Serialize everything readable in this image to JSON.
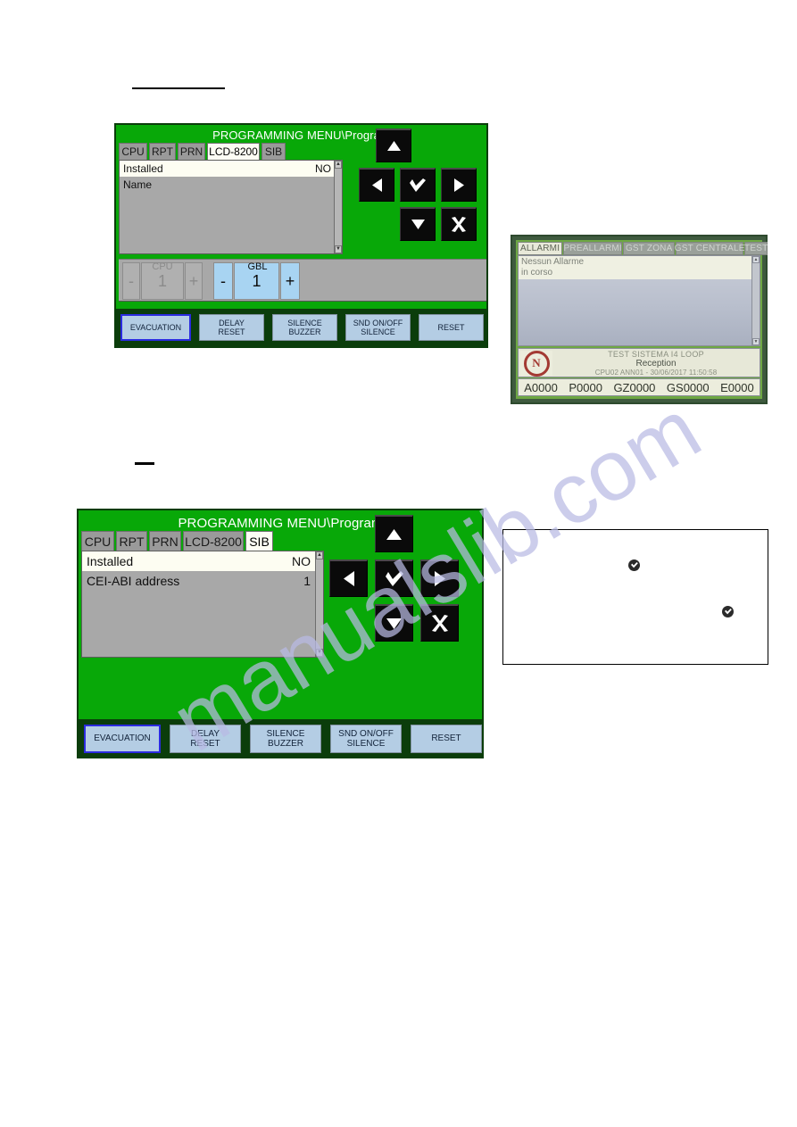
{
  "document": {
    "watermark": "manualslib.com",
    "rules": [
      "heading-underline-top",
      "heading-underline-mid"
    ]
  },
  "panel_lcd8200": {
    "title": "PROGRAMMING MENU\\Program",
    "tabs": [
      {
        "label": "CPU",
        "active": false
      },
      {
        "label": "RPT",
        "active": false
      },
      {
        "label": "PRN",
        "active": false
      },
      {
        "label": "LCD-8200",
        "active": true
      },
      {
        "label": "SIB",
        "active": false
      }
    ],
    "rows": [
      {
        "label": "Installed",
        "value": "NO",
        "selected": true
      },
      {
        "label": "Name",
        "value": "",
        "selected": false
      }
    ],
    "keypad": [
      {
        "name": "up-arrow-icon",
        "glyph": "up"
      },
      {
        "name": "left-arrow-icon",
        "glyph": "left"
      },
      {
        "name": "check-icon",
        "glyph": "check"
      },
      {
        "name": "right-arrow-icon",
        "glyph": "right"
      },
      {
        "name": "down-arrow-icon",
        "glyph": "down"
      },
      {
        "name": "close-x-icon",
        "glyph": "cross"
      }
    ],
    "steppers": [
      {
        "label": "CPU",
        "value": "1",
        "minus": "-",
        "plus": "+",
        "state": "disabled"
      },
      {
        "label": "GBL",
        "value": "1",
        "minus": "-",
        "plus": "+",
        "state": "active"
      }
    ],
    "commands": [
      {
        "label": "EVACUATION",
        "focused": true
      },
      {
        "label": "DELAY\nRESET",
        "focused": false
      },
      {
        "label": "SILENCE\nBUZZER",
        "focused": false
      },
      {
        "label": "SND ON/OFF\nSILENCE",
        "focused": false
      },
      {
        "label": "RESET",
        "focused": false
      }
    ]
  },
  "panel_sib": {
    "title": "PROGRAMMING MENU\\Program",
    "tabs": [
      {
        "label": "CPU",
        "active": false
      },
      {
        "label": "RPT",
        "active": false
      },
      {
        "label": "PRN",
        "active": false
      },
      {
        "label": "LCD-8200",
        "active": false
      },
      {
        "label": "SIB",
        "active": true
      }
    ],
    "rows": [
      {
        "label": "Installed",
        "value": "NO",
        "selected": true
      },
      {
        "label": "CEI-ABI address",
        "value": "1",
        "selected": false
      }
    ],
    "keypad": [
      {
        "name": "up-arrow-icon",
        "glyph": "up"
      },
      {
        "name": "left-arrow-icon",
        "glyph": "left"
      },
      {
        "name": "check-icon",
        "glyph": "check"
      },
      {
        "name": "right-arrow-icon",
        "glyph": "right"
      },
      {
        "name": "down-arrow-icon",
        "glyph": "down"
      },
      {
        "name": "close-x-icon",
        "glyph": "cross"
      }
    ],
    "commands": [
      {
        "label": "EVACUATION",
        "focused": true
      },
      {
        "label": "DELAY\nRESET",
        "focused": false
      },
      {
        "label": "SILENCE\nBUZZER",
        "focused": false
      },
      {
        "label": "SND ON/OFF\nSILENCE",
        "focused": false
      },
      {
        "label": "RESET",
        "focused": false
      }
    ]
  },
  "panel_alarms": {
    "tabs": [
      {
        "label": "ALLARMI",
        "active": true
      },
      {
        "label": "PREALLARMI",
        "active": false
      },
      {
        "label": "GST ZONA",
        "active": false
      },
      {
        "label": "GST CENTRALE",
        "active": false
      },
      {
        "label": "TEST",
        "active": false
      }
    ],
    "message_line_1": "Nessun Allarme",
    "message_line_2": "in corso",
    "logo_letter": "N",
    "info_line_1": "TEST SISTEMA I4 LOOP",
    "info_line_2": "Reception",
    "info_line_3": "CPU02 ANN01 - 30/06/2017 11:50:58",
    "counters": [
      "A0000",
      "P0000",
      "GZ0000",
      "GS0000",
      "E0000"
    ]
  },
  "note_box": {
    "checks": [
      "check-badge-1",
      "check-badge-2"
    ]
  }
}
